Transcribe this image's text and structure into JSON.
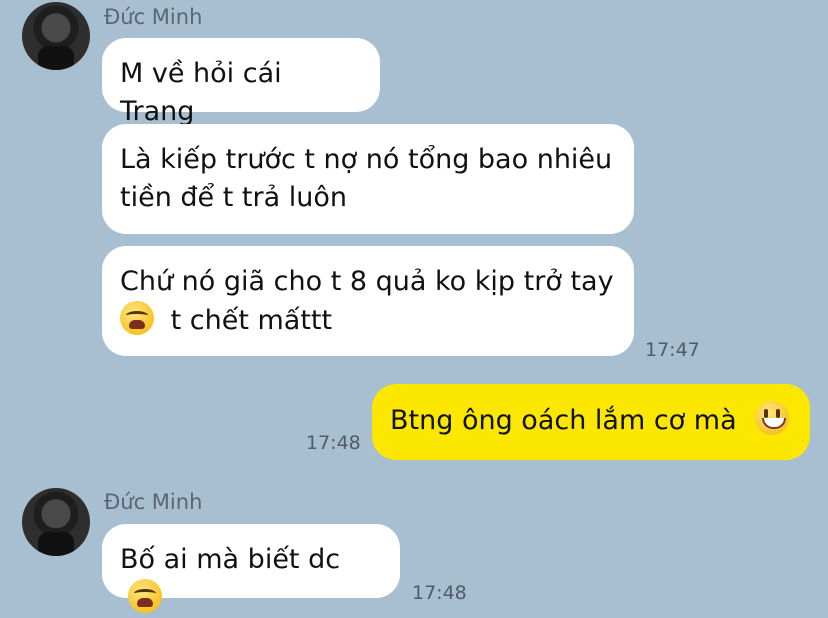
{
  "messages": [
    {
      "sender": "Đức Minh",
      "text": "M về hỏi cái Trang"
    },
    {
      "text": "Là kiếp trước t nợ nó tổng bao nhiêu tiền để t trả luôn",
      "line1": "Là kiếp trước t nợ nó tổng bao nhiêu",
      "line2": "tiền để t trả luôn"
    },
    {
      "line1": "Chứ nó giã cho t 8 quả ko kịp trở tay",
      "line2": "t chết mấttt",
      "emoji": "crying-face-icon",
      "time": "17:47"
    },
    {
      "text": "Btng ông oách lắm cơ mà",
      "emoji": "grinning-face-icon",
      "time": "17:48"
    },
    {
      "sender": "Đức Minh",
      "text": "Bố ai mà biết dc",
      "emoji": "crying-face-icon",
      "time": "17:48"
    }
  ],
  "colors": {
    "background": "#a7bfd1",
    "incoming": "#ffffff",
    "outgoing": "#fbe700"
  }
}
